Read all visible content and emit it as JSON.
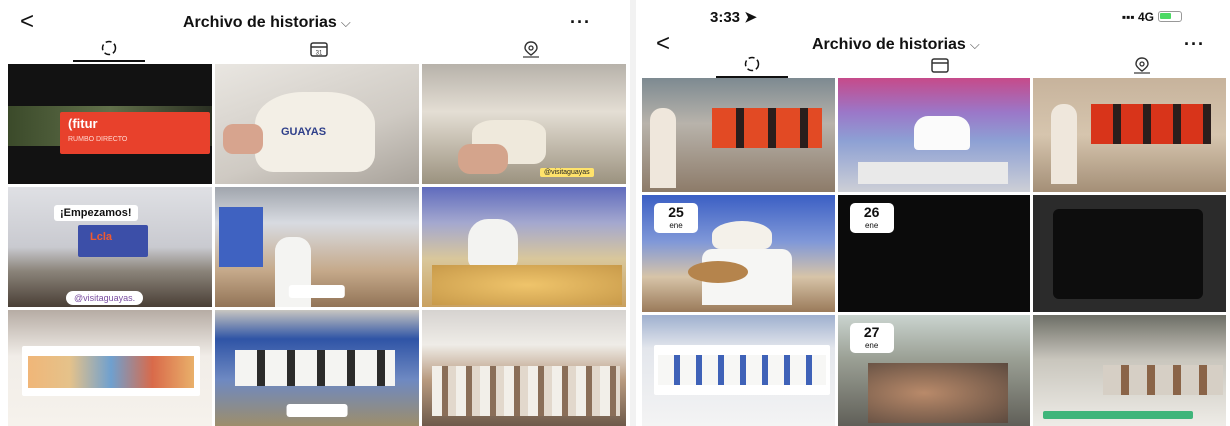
{
  "left": {
    "header": {
      "back": "<",
      "title": "Archivo de historias",
      "more": "···"
    },
    "tabs": [
      "stories-icon",
      "calendar-icon",
      "location-icon"
    ],
    "captions": {
      "fitur_logo": "(fitur",
      "fitur_sub": "RUMBO DIRECTO",
      "bag_print": "GUAYAS",
      "bag_tag": "@visitaguayas",
      "empezamos": "¡Empezamos!",
      "stage_sign": "Lcla",
      "handle": "@visitaguayas."
    }
  },
  "right": {
    "status": {
      "time": "3:33",
      "signal": "4G"
    },
    "header": {
      "back": "<",
      "title": "Archivo de historias",
      "more": "···"
    },
    "tabs": [
      "stories-icon",
      "calendar-icon",
      "location-icon"
    ],
    "badges": [
      {
        "day": "25",
        "month": "ene"
      },
      {
        "day": "26",
        "month": "ene"
      },
      {
        "day": "27",
        "month": "ene"
      }
    ]
  },
  "colors": {
    "accent": "#e8412c",
    "ink": "#111111"
  }
}
